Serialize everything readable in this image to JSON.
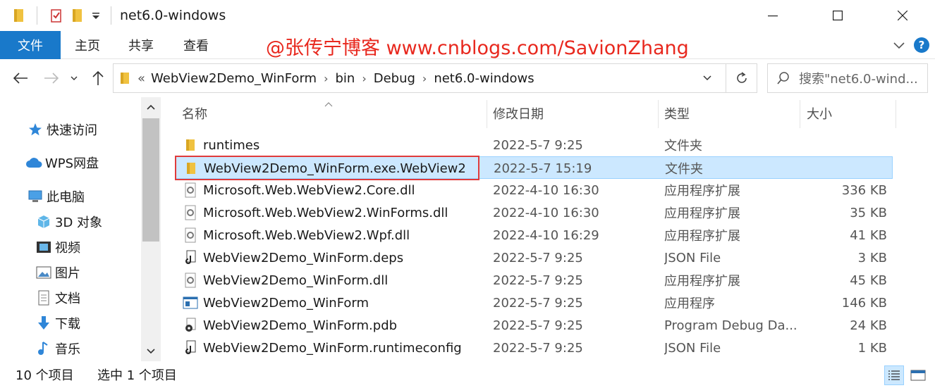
{
  "window": {
    "title": "net6.0-windows"
  },
  "ribbon": {
    "tabs": [
      "文件",
      "主页",
      "共享",
      "查看"
    ],
    "watermark": "@张传宁博客 www.cnblogs.com/SavionZhang",
    "help_label": "?"
  },
  "address": {
    "overflow": "«",
    "crumbs": [
      "WebView2Demo_WinForm",
      "bin",
      "Debug",
      "net6.0-windows"
    ],
    "search_placeholder": "搜索\"net6.0-wind..."
  },
  "nav_pane": {
    "items": [
      {
        "label": "快速访问",
        "icon": "star-icon"
      },
      {
        "label": "WPS网盘",
        "icon": "cloud-icon"
      },
      {
        "label": "此电脑",
        "icon": "computer-icon"
      },
      {
        "label": "3D 对象",
        "icon": "cube-icon"
      },
      {
        "label": "视频",
        "icon": "video-icon"
      },
      {
        "label": "图片",
        "icon": "picture-icon"
      },
      {
        "label": "文档",
        "icon": "document-icon"
      },
      {
        "label": "下载",
        "icon": "download-icon"
      },
      {
        "label": "音乐",
        "icon": "music-icon"
      }
    ]
  },
  "file_list": {
    "columns": [
      "名称",
      "修改日期",
      "类型",
      "大小"
    ],
    "rows": [
      {
        "name": "runtimes",
        "date": "2022-5-7 9:25",
        "type": "文件夹",
        "size": "",
        "icon": "folder-icon"
      },
      {
        "name": "WebView2Demo_WinForm.exe.WebView2",
        "date": "2022-5-7 15:19",
        "type": "文件夹",
        "size": "",
        "icon": "folder-icon"
      },
      {
        "name": "Microsoft.Web.WebView2.Core.dll",
        "date": "2022-4-10 16:30",
        "type": "应用程序扩展",
        "size": "336 KB",
        "icon": "dll-icon"
      },
      {
        "name": "Microsoft.Web.WebView2.WinForms.dll",
        "date": "2022-4-10 16:30",
        "type": "应用程序扩展",
        "size": "35 KB",
        "icon": "dll-icon"
      },
      {
        "name": "Microsoft.Web.WebView2.Wpf.dll",
        "date": "2022-4-10 16:29",
        "type": "应用程序扩展",
        "size": "41 KB",
        "icon": "dll-icon"
      },
      {
        "name": "WebView2Demo_WinForm.deps",
        "date": "2022-5-7 9:25",
        "type": "JSON File",
        "size": "3 KB",
        "icon": "json-icon"
      },
      {
        "name": "WebView2Demo_WinForm.dll",
        "date": "2022-5-7 9:25",
        "type": "应用程序扩展",
        "size": "45 KB",
        "icon": "dll-icon"
      },
      {
        "name": "WebView2Demo_WinForm",
        "date": "2022-5-7 9:25",
        "type": "应用程序",
        "size": "146 KB",
        "icon": "exe-icon"
      },
      {
        "name": "WebView2Demo_WinForm.pdb",
        "date": "2022-5-7 9:25",
        "type": "Program Debug Da...",
        "size": "24 KB",
        "icon": "pdb-icon"
      },
      {
        "name": "WebView2Demo_WinForm.runtimeconfig",
        "date": "2022-5-7 9:25",
        "type": "JSON File",
        "size": "1 KB",
        "icon": "json-icon"
      }
    ],
    "selected_index": 1
  },
  "status": {
    "item_count": "10 个项目",
    "selected_count": "选中 1 个项目"
  },
  "colors": {
    "accent": "#1979ca",
    "selection": "#cce8ff",
    "highlight_border": "#e03b3b",
    "watermark": "#e8281e"
  }
}
